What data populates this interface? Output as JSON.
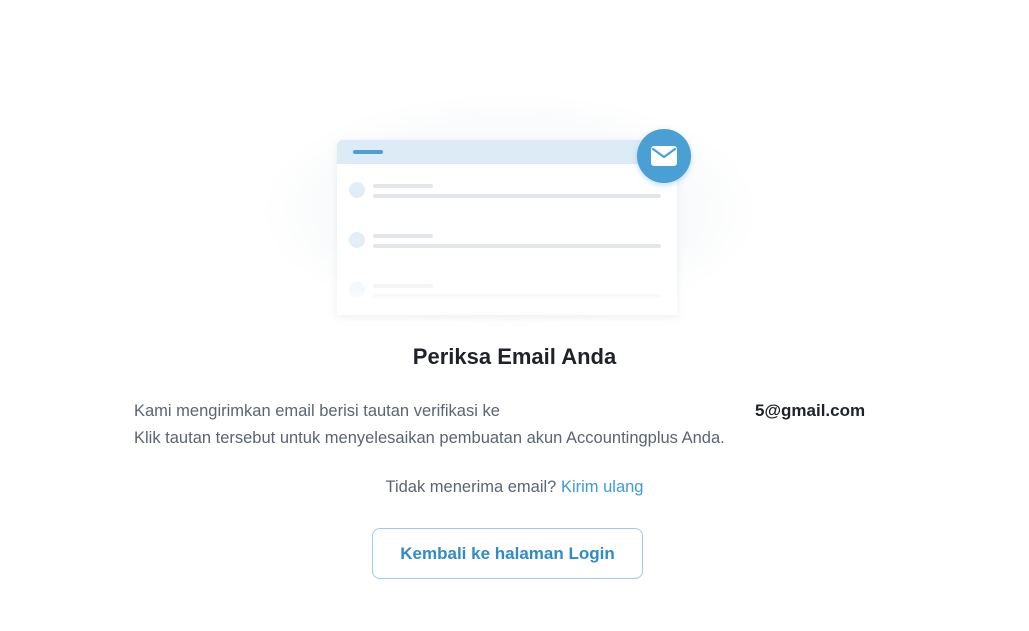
{
  "illustration": {
    "badge_icon": "envelope-icon",
    "accent_color": "#4aa0d5",
    "header_color": "#dcebf6"
  },
  "heading": "Periksa Email Anda",
  "message": {
    "line1": "Kami mengirimkan email berisi tautan verifikasi ke",
    "email": "5@gmail.com",
    "line2": "Klik tautan tersebut untuk menyelesaikan pembuatan akun Accountingplus Anda."
  },
  "resend": {
    "prompt": "Tidak menerima email?",
    "link_label": "Kirim ulang",
    "link_color": "#3f9bd3"
  },
  "back_button": {
    "label": "Kembali ke halaman Login",
    "color": "#2f8cc6"
  }
}
